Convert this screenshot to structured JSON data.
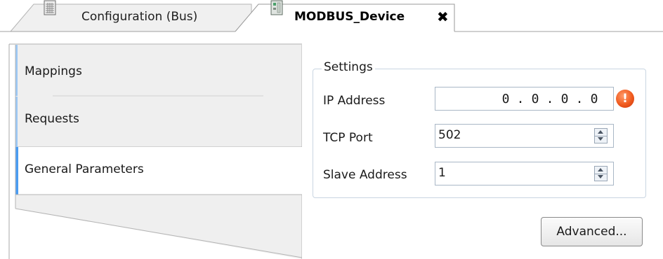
{
  "tabs": [
    {
      "label": "Configuration (Bus)",
      "active": false
    },
    {
      "label": "MODBUS_Device",
      "active": true,
      "close_symbol": "✖"
    }
  ],
  "nav": {
    "items": [
      {
        "label": "Mappings"
      },
      {
        "label": "Requests"
      },
      {
        "label": "General Parameters",
        "selected": true
      }
    ]
  },
  "settings": {
    "group_label": "Settings",
    "ip_address": {
      "label": "IP Address",
      "octets": [
        "0",
        "0",
        "0",
        "0"
      ],
      "separator": ".",
      "error_symbol": "!"
    },
    "tcp_port": {
      "label": "TCP Port",
      "value": "502"
    },
    "slave_address": {
      "label": "Slave Address",
      "value": "1"
    }
  },
  "advanced_button": {
    "label": "Advanced..."
  },
  "icons": {
    "tab1": "configuration-grid-icon",
    "tab2": "device-icon",
    "error": "error-exclamation-icon"
  },
  "colors": {
    "nav_accent": "#4a9cf2",
    "nav_accent_light": "#9cc8f5",
    "error": "#f05a1e"
  }
}
